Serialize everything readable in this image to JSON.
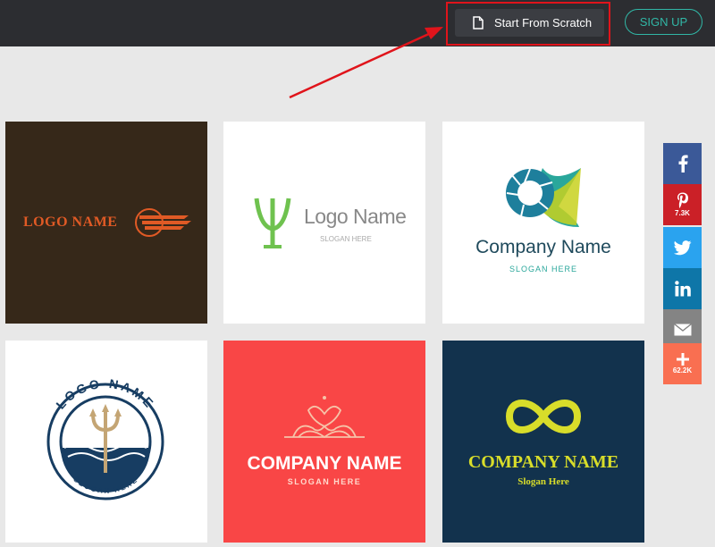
{
  "header": {
    "start_button_label": "Start From Scratch",
    "signup_label": "SIGN UP"
  },
  "logos": [
    {
      "name": "LOGO NAME",
      "slogan": ""
    },
    {
      "name": "Logo Name",
      "slogan": "SLOGAN HERE"
    },
    {
      "name": "Company Name",
      "slogan": "SLOGAN HERE"
    },
    {
      "name": "LOGO NAME",
      "slogan": "SLOGAN HERE"
    },
    {
      "name": "COMPANY NAME",
      "slogan": "SLOGAN HERE"
    },
    {
      "name": "COMPANY NAME",
      "slogan": "Slogan Here"
    }
  ],
  "share": {
    "facebook": "",
    "pinterest_count": "7.3K",
    "twitter": "",
    "linkedin": "",
    "email": "",
    "more_count": "62.2K"
  },
  "colors": {
    "topbar": "#2c2d31",
    "accent_teal": "#31b7a6",
    "highlight_red": "#e0141b",
    "page_bg": "#e8e8e8"
  }
}
